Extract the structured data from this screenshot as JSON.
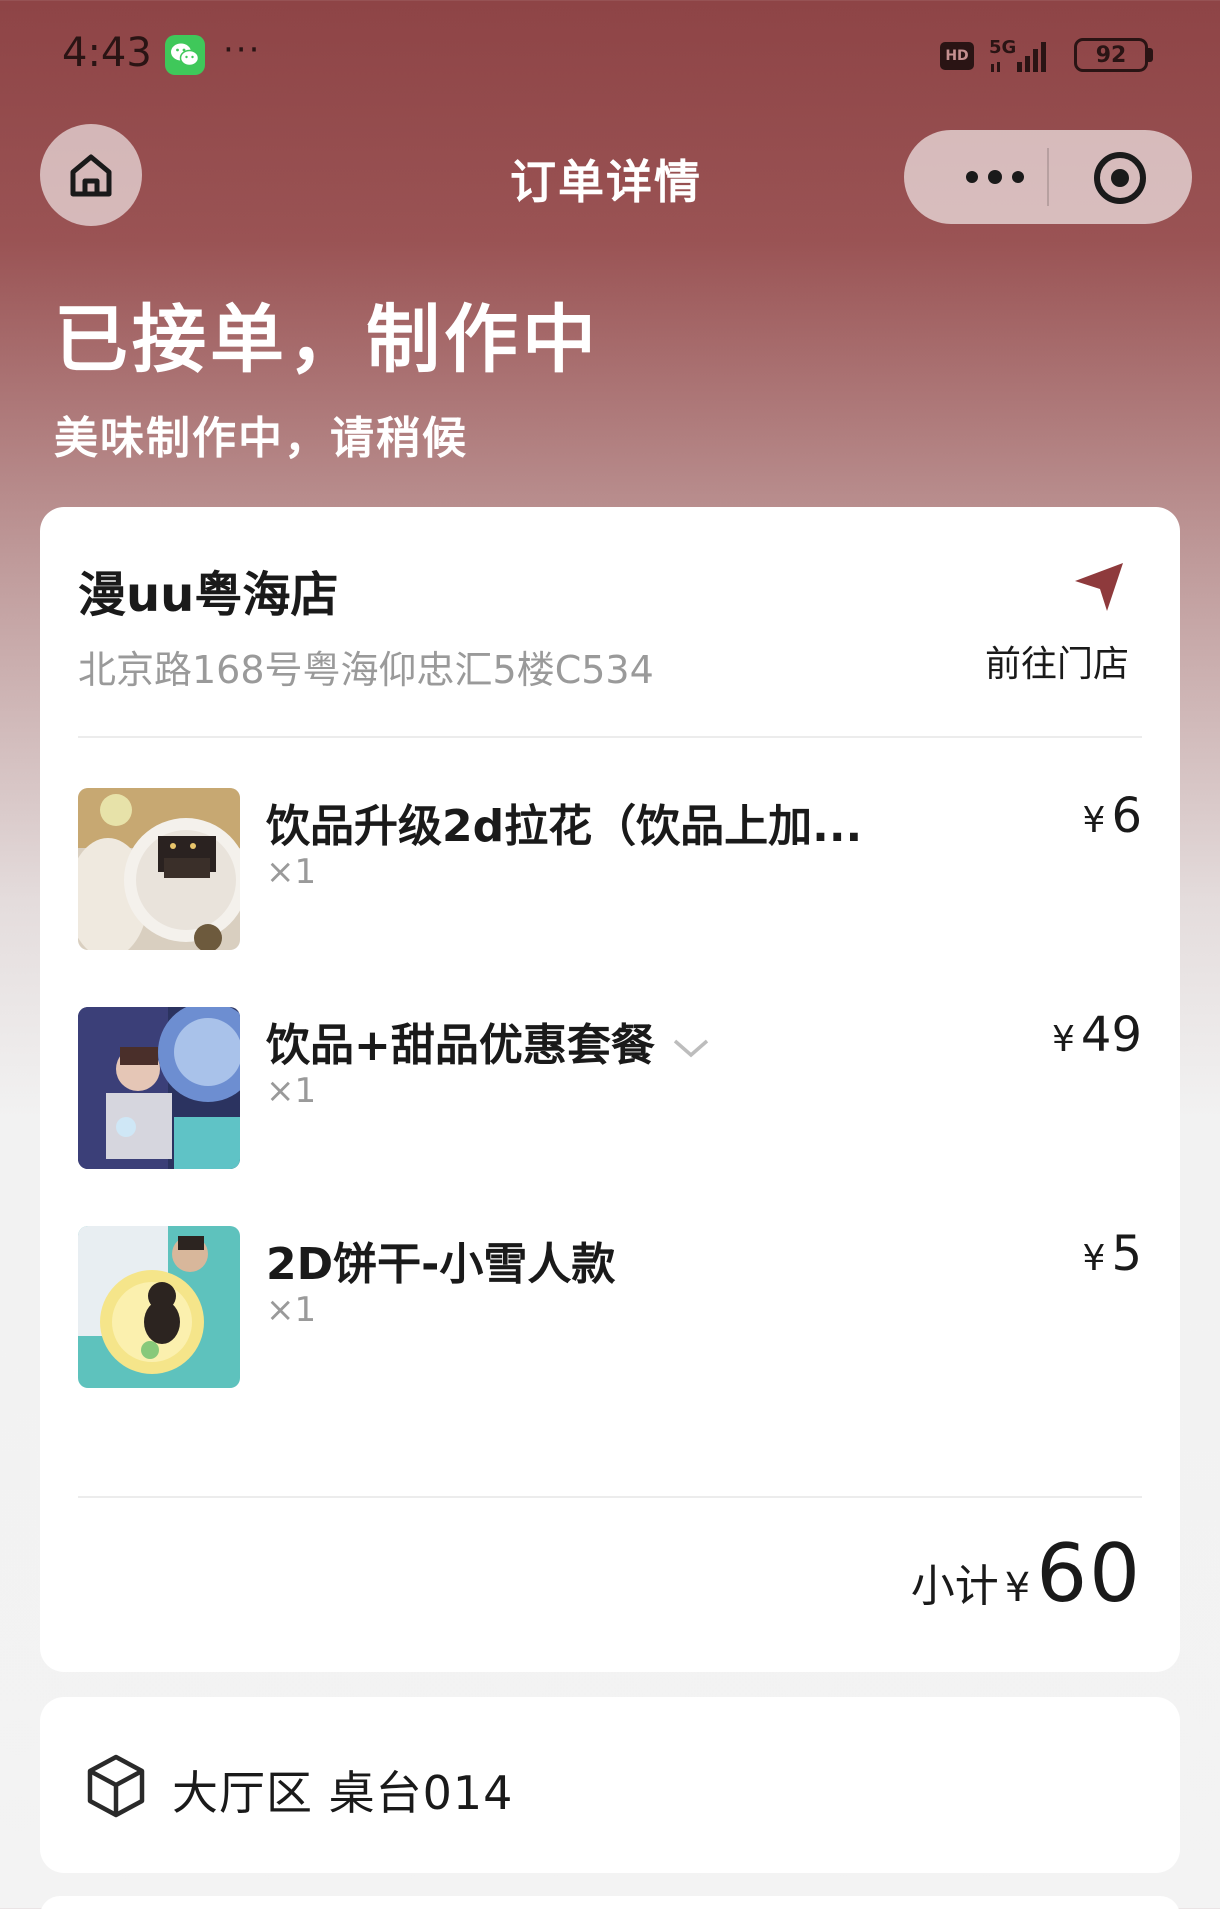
{
  "status_bar": {
    "time": "4:43",
    "dots": "···",
    "hd": "HD",
    "network": "5G",
    "battery": "92"
  },
  "nav": {
    "title": "订单详情"
  },
  "order": {
    "status": "已接单，制作中",
    "subtitle": "美味制作中，请稍候"
  },
  "store": {
    "name": "漫uu粤海店",
    "address": "北京路168号粤海仰忠汇5楼C534",
    "navigate_label": "前往门店"
  },
  "items": [
    {
      "name": "饮品升级2d拉花（饮品上加...",
      "qty": "×1",
      "currency": "¥",
      "price": "6"
    },
    {
      "name": "饮品+甜品优惠套餐",
      "qty": "×1",
      "currency": "¥",
      "price": "49"
    },
    {
      "name": "2D饼干-小雪人款",
      "qty": "×1",
      "currency": "¥",
      "price": "5"
    }
  ],
  "subtotal": {
    "label": "小计",
    "currency": "¥",
    "amount": "60"
  },
  "table": {
    "text": "大厅区 桌台014"
  },
  "colors": {
    "header_top": "#8e4446",
    "card_bg": "#ffffff",
    "muted_text": "#9a9a9a",
    "nav_arrow": "#8e3a3c"
  }
}
